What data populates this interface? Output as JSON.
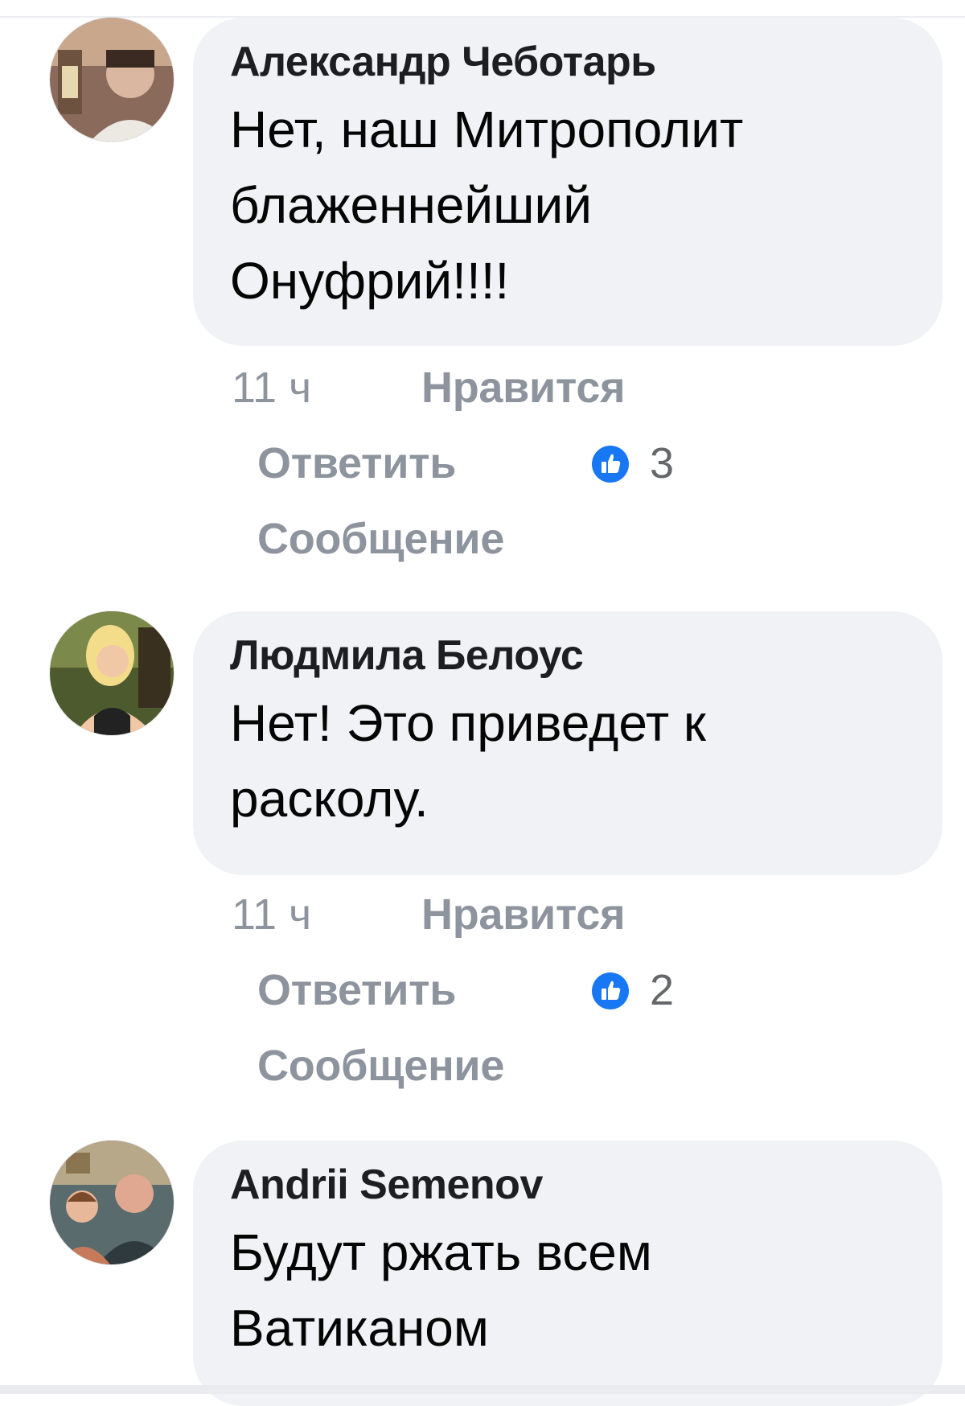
{
  "comments": [
    {
      "author": "Александр Чеботарь",
      "lines": [
        "Нет, наш Митрополит",
        "блаженнейший",
        "Онуфрий!!!!"
      ],
      "time": "11 ч",
      "like_label": "Нравится",
      "reply_label": "Ответить",
      "reaction_count": "3",
      "message_label": "Сообщение"
    },
    {
      "author": "Людмила Белоус",
      "lines": [
        "Нет! Это приведет к",
        "расколу."
      ],
      "time": "11 ч",
      "like_label": "Нравится",
      "reply_label": "Ответить",
      "reaction_count": "2",
      "message_label": "Сообщение"
    },
    {
      "author": "Andrii Semenov",
      "lines": [
        "Будут ржать всем",
        "Ватиканом"
      ]
    }
  ],
  "colors": {
    "bubble": "#f0f2f5",
    "author_text": "#1c1e21",
    "meta_text": "#8d949e",
    "like_blue": "#1877f2"
  },
  "icons": {
    "reaction": "thumbs-up-icon"
  }
}
